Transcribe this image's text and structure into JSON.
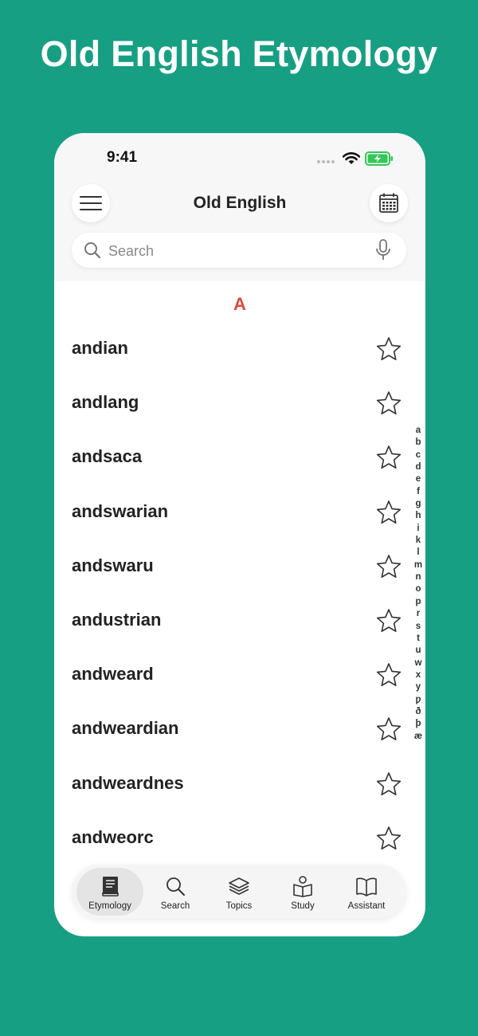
{
  "headline": "Old English Etymology",
  "status_bar": {
    "time": "9:41"
  },
  "nav": {
    "title": "Old English",
    "menu_icon": "hamburger-menu-icon",
    "calendar_icon": "calendar-icon"
  },
  "search": {
    "placeholder": "Search",
    "value": ""
  },
  "section_letter": "A",
  "words": [
    {
      "label": "andian"
    },
    {
      "label": "andlang"
    },
    {
      "label": "andsaca"
    },
    {
      "label": "andswarian"
    },
    {
      "label": "andswaru"
    },
    {
      "label": "andustrian"
    },
    {
      "label": "andweard"
    },
    {
      "label": "andweardian"
    },
    {
      "label": "andweardnes"
    },
    {
      "label": "andweorc"
    }
  ],
  "alpha_index": [
    "a",
    "b",
    "c",
    "d",
    "e",
    "f",
    "g",
    "h",
    "i",
    "k",
    "l",
    "m",
    "n",
    "o",
    "p",
    "r",
    "s",
    "t",
    "u",
    "w",
    "x",
    "y",
    "ƿ",
    "ð",
    "þ",
    "æ"
  ],
  "tabs": [
    {
      "label": "Etymology",
      "icon": "book-icon",
      "active": true
    },
    {
      "label": "Search",
      "icon": "search-icon",
      "active": false
    },
    {
      "label": "Topics",
      "icon": "layers-icon",
      "active": false
    },
    {
      "label": "Study",
      "icon": "reader-icon",
      "active": false
    },
    {
      "label": "Assistant",
      "icon": "open-book-icon",
      "active": false
    }
  ],
  "colors": {
    "background": "#179f83",
    "accent_letter": "#e0493b",
    "battery": "#34c759"
  }
}
